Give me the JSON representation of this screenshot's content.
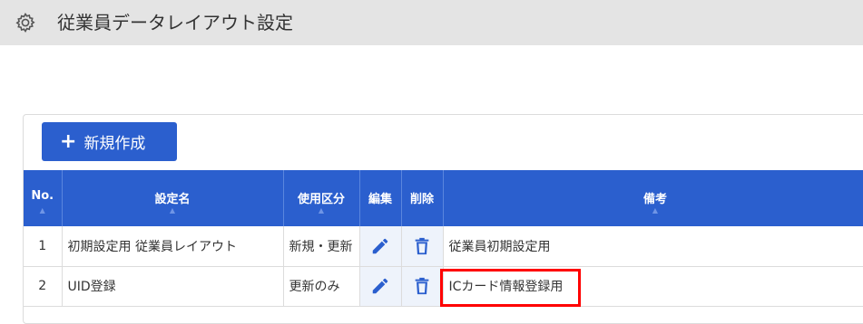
{
  "header": {
    "title": "従業員データレイアウト設定",
    "icon": "gear-icon"
  },
  "toolbar": {
    "add_label": "新規作成",
    "add_icon": "plus-icon"
  },
  "table": {
    "columns": [
      {
        "label": "No."
      },
      {
        "label": "設定名"
      },
      {
        "label": "使用区分"
      },
      {
        "label": "編集"
      },
      {
        "label": "削除"
      },
      {
        "label": "備考"
      }
    ],
    "rows": [
      {
        "no": "1",
        "name": "初期設定用 従業員レイアウト",
        "usage": "新規・更新",
        "note": "従業員初期設定用"
      },
      {
        "no": "2",
        "name": "UID登録",
        "usage": "更新のみ",
        "note": "ICカード情報登録用"
      }
    ]
  },
  "colors": {
    "accent": "#2b5fce",
    "highlight": "#ff0000",
    "header_bg": "#e4e4e4"
  }
}
